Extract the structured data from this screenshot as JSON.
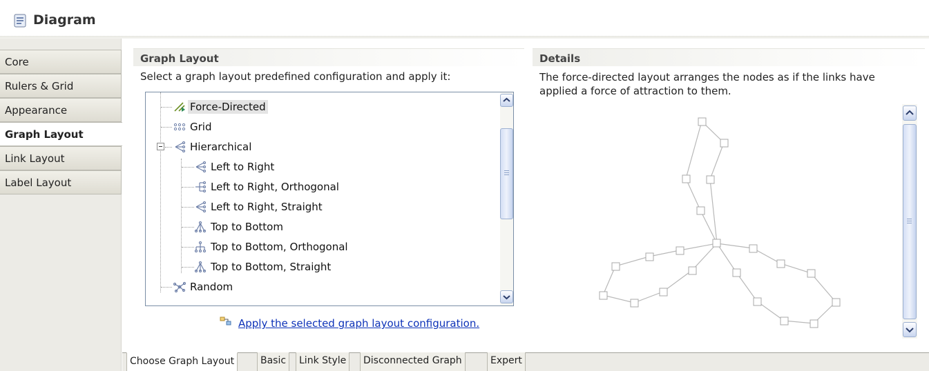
{
  "header": {
    "title": "Diagram",
    "icon": "diagram-icon"
  },
  "sidebar": {
    "items": [
      {
        "label": "Core",
        "active": false
      },
      {
        "label": "Rulers & Grid",
        "active": false
      },
      {
        "label": "Appearance",
        "active": false
      },
      {
        "label": "Graph Layout",
        "active": true
      },
      {
        "label": "Link Layout",
        "active": false
      },
      {
        "label": "Label Layout",
        "active": false
      }
    ]
  },
  "graph_layout": {
    "heading": "Graph Layout",
    "description": "Select a graph layout predefined configuration and apply it:",
    "tree": [
      {
        "label": "Force-Directed",
        "icon": "force-directed-icon",
        "selected": true
      },
      {
        "label": "Grid",
        "icon": "grid-layout-icon"
      },
      {
        "label": "Hierarchical",
        "icon": "hierarchical-icon",
        "expanded": true
      },
      {
        "label": "Left to Right",
        "icon": "left-to-right-icon"
      },
      {
        "label": "Left to Right, Orthogonal",
        "icon": "left-to-right-orthogonal-icon"
      },
      {
        "label": "Left to Right, Straight",
        "icon": "left-to-right-straight-icon"
      },
      {
        "label": "Top to Bottom",
        "icon": "top-to-bottom-icon"
      },
      {
        "label": "Top to Bottom, Orthogonal",
        "icon": "top-to-bottom-orthogonal-icon"
      },
      {
        "label": "Top to Bottom, Straight",
        "icon": "top-to-bottom-straight-icon"
      },
      {
        "label": "Random",
        "icon": "random-layout-icon"
      }
    ],
    "apply_link": "Apply the selected graph layout configuration."
  },
  "details": {
    "heading": "Details",
    "description": "The force-directed layout arranges the nodes as if the links have applied a force of attraction to them."
  },
  "bottom_tabs": [
    {
      "label": "Choose Graph Layout",
      "active": true
    },
    {
      "label": "Basic",
      "active": false
    },
    {
      "label": "Link Style",
      "active": false
    },
    {
      "label": "Disconnected Graph",
      "active": false
    },
    {
      "label": "Expert",
      "active": false
    }
  ],
  "colors": {
    "accent": "#0d32b8",
    "sidebar_bg": "#ecebe6",
    "selection": "#e4e4e4"
  }
}
